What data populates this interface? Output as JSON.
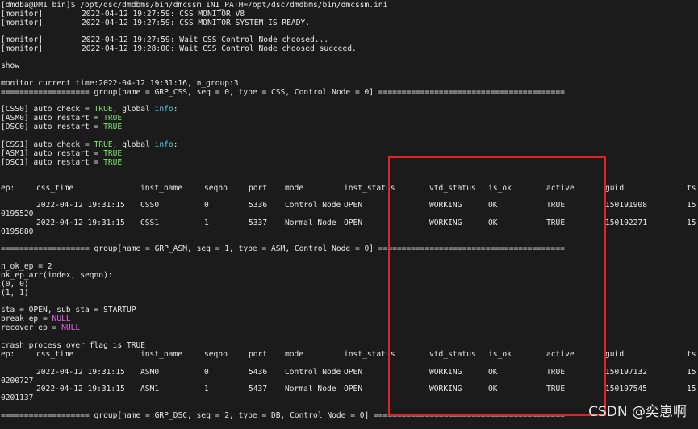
{
  "header": {
    "prompt": "[dmdba@DM1 bin]$ /opt/dsc/dmdbms/bin/dmcssm INI_PATH=/opt/dsc/dmdbms/bin/dmcssm.ini",
    "monitor_tag": "[monitor]",
    "msg1": "2022-04-12 19:27:59: CSS MONITOR V8",
    "msg2": "2022-04-12 19:27:59: CSS MONITOR SYSTEM IS READY.",
    "msg3": "2022-04-12 19:27:59: Wait CSS Control Node choosed...",
    "msg4": "2022-04-12 19:28:00: Wait CSS Control Node choosed succeed."
  },
  "command": "show",
  "current_time_line": "monitor current time:2022-04-12 19:31:16, n_group:3",
  "group_css_line": "=================== group[name = GRP_CSS, seq = 0, type = CSS, Control Node = 0] ========================================",
  "group_asm_line": "=================== group[name = GRP_ASM, seq = 1, type = ASM, Control Node = 0] ========================================",
  "group_dsc_line": "=================== group[name = GRP_DSC, seq = 2, type = DB, Control Node = 0] =========================================",
  "auto": {
    "css0_pre": "[CSS0] auto check = ",
    "css1_pre": "[CSS1] auto check = ",
    "global_mid": ", global ",
    "info": "info",
    "colon": ":",
    "asm0_pre": "[ASM0] auto restart = ",
    "dsc0_pre": "[DSC0] auto restart = ",
    "asm1_pre": "[ASM1] auto restart = ",
    "dsc1_pre": "[DSC1] auto restart = ",
    "true": "TRUE"
  },
  "columns": [
    "ep:",
    "css_time",
    "inst_name",
    "seqno",
    "port",
    "mode",
    "inst_status",
    "vtd_status",
    "is_ok",
    "active",
    "guid",
    "ts"
  ],
  "css_rows": [
    {
      "css_time": "2022-04-12 19:31:15",
      "inst_name": "CSS0",
      "seqno": "0",
      "port": "5336",
      "mode": "Control Node",
      "inst_status": "OPEN",
      "vtd_status": "WORKING",
      "is_ok": "OK",
      "active": "TRUE",
      "guid": "150191908",
      "ts": "15",
      "wrap": "0195520"
    },
    {
      "css_time": "2022-04-12 19:31:15",
      "inst_name": "CSS1",
      "seqno": "1",
      "port": "5337",
      "mode": "Normal Node",
      "inst_status": "OPEN",
      "vtd_status": "WORKING",
      "is_ok": "OK",
      "active": "TRUE",
      "guid": "150192271",
      "ts": "15",
      "wrap": "0195880"
    }
  ],
  "asm_rows": [
    {
      "css_time": "2022-04-12 19:31:15",
      "inst_name": "ASM0",
      "seqno": "0",
      "port": "5436",
      "mode": "Control Node",
      "inst_status": "OPEN",
      "vtd_status": "WORKING",
      "is_ok": "OK",
      "active": "TRUE",
      "guid": "150197132",
      "ts": "15",
      "wrap": "0200727"
    },
    {
      "css_time": "2022-04-12 19:31:15",
      "inst_name": "ASM1",
      "seqno": "1",
      "port": "5437",
      "mode": "Normal Node",
      "inst_status": "OPEN",
      "vtd_status": "WORKING",
      "is_ok": "OK",
      "active": "TRUE",
      "guid": "150197545",
      "ts": "15",
      "wrap": "0201137"
    }
  ],
  "asm_info": {
    "n_ok_ep": "n_ok_ep = 2",
    "ok_ep_arr": "ok_ep_arr(index, seqno):",
    "pair0": "(0, 0)",
    "pair1": "(1, 1)",
    "sta": "sta = OPEN, sub_sta = STARTUP",
    "break_pre": "break ep = ",
    "recover_pre": "recover ep = ",
    "null": "NULL",
    "crash": "crash process over flag is TRUE"
  },
  "watermark": "CSDN @奕崽啊",
  "colors": {
    "background": "#1b1b1b",
    "text": "#e6e6e6",
    "true": "#7fe26f",
    "info": "#4fc7e8",
    "null": "#e467e6",
    "highlight_box": "#e02424"
  }
}
